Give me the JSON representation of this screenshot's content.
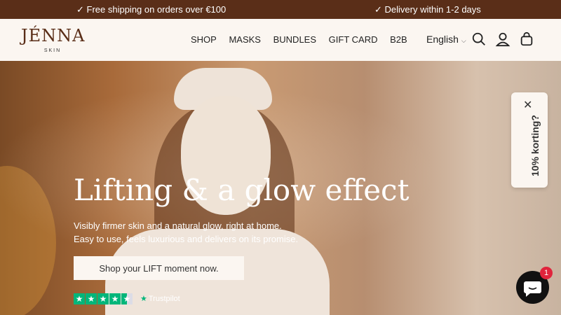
{
  "announcement": {
    "left": "✓ Free shipping on orders over €100",
    "right": "✓ Delivery within 1-2 days"
  },
  "header": {
    "logo_main": "JÉNNA",
    "logo_sub": "SKIN",
    "nav": [
      "SHOP",
      "MASKS",
      "BUNDLES",
      "GIFT CARD",
      "B2B"
    ],
    "language": "English",
    "icons": [
      "search-icon",
      "account-icon",
      "cart-icon"
    ]
  },
  "hero": {
    "title": "Lifting & a glow effect",
    "subtitle_line1": "Visibly firmer skin and a natural glow, right at home.",
    "subtitle_line2": "Easy to use, feels luxurious and delivers on its promise.",
    "cta_label": "Shop your LIFT moment now.",
    "rating_stars": 4.5,
    "trustpilot_label": "Trustpilot"
  },
  "discount_tab": {
    "label": "10% korting?"
  },
  "chat": {
    "badge_count": "1"
  },
  "colors": {
    "announcement_bg": "#5a2e18",
    "header_bg": "#fbf6f1",
    "trustpilot_green": "#00b67a",
    "chat_badge": "#e0243c"
  }
}
